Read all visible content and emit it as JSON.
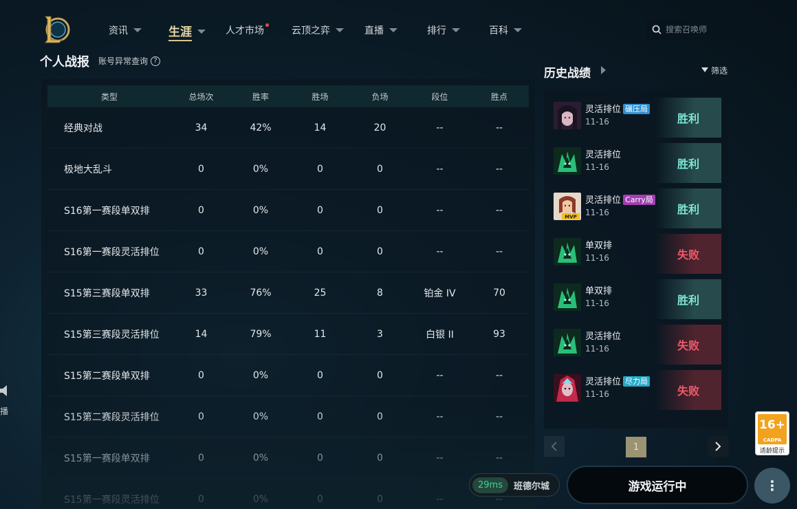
{
  "nav": {
    "items": [
      {
        "label": "资讯",
        "chevron": true
      },
      {
        "label": "生涯",
        "chevron": true,
        "active": true
      },
      {
        "label": "人才市场",
        "chevron": false,
        "dot": true
      },
      {
        "label": "云顶之弈",
        "chevron": true
      },
      {
        "label": "直播",
        "chevron": true
      },
      {
        "label": "排行",
        "chevron": true
      },
      {
        "label": "百科",
        "chevron": true
      }
    ],
    "search_placeholder": "搜索召唤师"
  },
  "stats": {
    "title": "个人战报",
    "abnormal_link": "账号异常查询",
    "help": "?",
    "columns": [
      "类型",
      "总场次",
      "胜率",
      "胜场",
      "负场",
      "段位",
      "胜点"
    ],
    "rows": [
      [
        "经典对战",
        "34",
        "42%",
        "14",
        "20",
        "--",
        "--"
      ],
      [
        "极地大乱斗",
        "0",
        "0%",
        "0",
        "0",
        "--",
        "--"
      ],
      [
        "S16第一赛段单双排",
        "0",
        "0%",
        "0",
        "0",
        "--",
        "--"
      ],
      [
        "S16第一赛段灵活排位",
        "0",
        "0%",
        "0",
        "0",
        "--",
        "--"
      ],
      [
        "S15第三赛段单双排",
        "33",
        "76%",
        "25",
        "8",
        "铂金 IV",
        "70"
      ],
      [
        "S15第三赛段灵活排位",
        "14",
        "79%",
        "11",
        "3",
        "白银 II",
        "93"
      ],
      [
        "S15第二赛段单双排",
        "0",
        "0%",
        "0",
        "0",
        "--",
        "--"
      ],
      [
        "S15第二赛段灵活排位",
        "0",
        "0%",
        "0",
        "0",
        "--",
        "--"
      ],
      [
        "S15第一赛段单双排",
        "0",
        "0%",
        "0",
        "0",
        "--",
        "--"
      ],
      [
        "S15第一赛段灵活排位",
        "0",
        "0%",
        "0",
        "0",
        "--",
        "--"
      ]
    ]
  },
  "history": {
    "title": "历史战绩",
    "filter": "筛选",
    "matches": [
      {
        "mode": "灵活排位",
        "tag": "碾压局",
        "tag_color": "#2f8fd0",
        "date": "11-16",
        "result": "胜利",
        "win": true,
        "champ": "dark-haired"
      },
      {
        "mode": "灵活排位",
        "tag": "",
        "tag_color": "",
        "date": "11-16",
        "result": "胜利",
        "win": true,
        "champ": "green"
      },
      {
        "mode": "灵活排位",
        "tag": "Carry局",
        "tag_color": "#a13fb0",
        "date": "11-16",
        "result": "胜利",
        "win": true,
        "champ": "mvp",
        "mvp": "MVP"
      },
      {
        "mode": "单双排",
        "tag": "",
        "tag_color": "",
        "date": "11-16",
        "result": "失败",
        "win": false,
        "champ": "green"
      },
      {
        "mode": "单双排",
        "tag": "",
        "tag_color": "",
        "date": "11-16",
        "result": "胜利",
        "win": true,
        "champ": "green"
      },
      {
        "mode": "灵活排位",
        "tag": "",
        "tag_color": "",
        "date": "11-16",
        "result": "失败",
        "win": false,
        "champ": "green"
      },
      {
        "mode": "灵活排位",
        "tag": "尽力局",
        "tag_color": "#27a9c9",
        "date": "11-16",
        "result": "失败",
        "win": false,
        "champ": "red"
      }
    ],
    "page": "1"
  },
  "bottom": {
    "ping": "29ms",
    "server": "班德尔城",
    "game_status": "游戏运行中",
    "more": "⋮"
  },
  "age_badge": {
    "rating": "16+",
    "org": "CADPA",
    "label": "适龄提示"
  },
  "left_widget": {
    "label": "播"
  },
  "colors": {
    "win": "#7fe6d6",
    "loss": "#ee5a6a",
    "accent": "#e8d8a4"
  }
}
